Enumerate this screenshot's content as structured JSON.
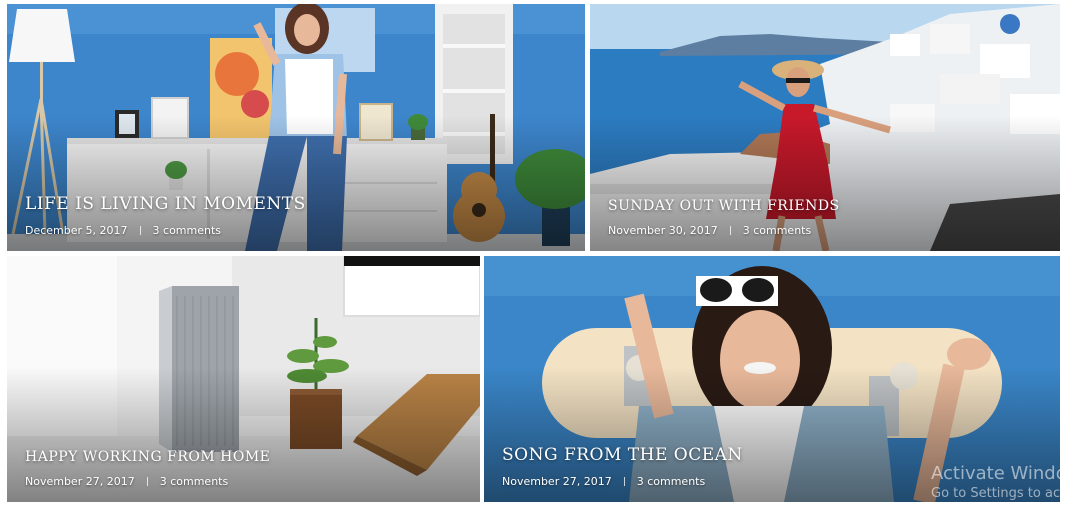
{
  "posts": [
    {
      "title": "LIFE IS LIVING IN MOMENTS",
      "date": "December 5, 2017",
      "comments": "3 comments"
    },
    {
      "title": "SUNDAY OUT WITH FRIENDS",
      "date": "November 30, 2017",
      "comments": "3 comments"
    },
    {
      "title": "HAPPY WORKING FROM HOME",
      "date": "November 27, 2017",
      "comments": "3 comments"
    },
    {
      "title": "SONG FROM THE OCEAN",
      "date": "November 27, 2017",
      "comments": "3 comments"
    }
  ],
  "watermark": {
    "line1": "Activate Windo",
    "line2": "Go to Settings to ac"
  },
  "colors": {
    "wall_blue": "#3f86c9",
    "sea_blue": "#2f7fc4",
    "white": "#ffffff"
  }
}
